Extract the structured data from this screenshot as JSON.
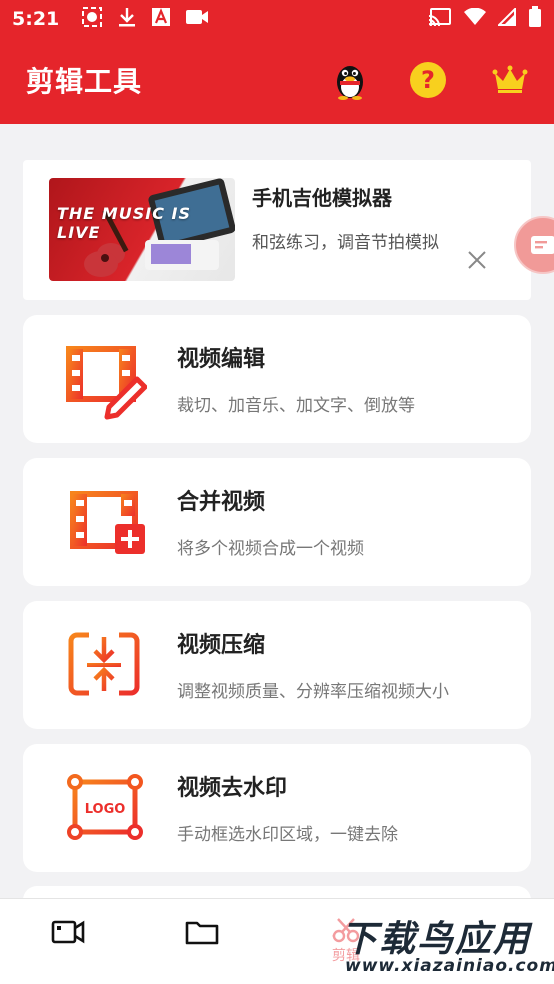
{
  "status_bar": {
    "time": "5:21"
  },
  "app_bar": {
    "title": "剪辑工具"
  },
  "banner": {
    "image_text": "THE MUSIC IS LIVE",
    "title": "手机吉他模拟器",
    "subtitle": "和弦练习，调音节拍模拟"
  },
  "tools": [
    {
      "title": "视频编辑",
      "subtitle": "裁切、加音乐、加文字、倒放等",
      "icon": "film-edit-icon"
    },
    {
      "title": "合并视频",
      "subtitle": "将多个视频合成一个视频",
      "icon": "film-add-icon"
    },
    {
      "title": "视频压缩",
      "subtitle": "调整视频质量、分辨率压缩视频大小",
      "icon": "compress-icon"
    },
    {
      "title": "视频去水印",
      "subtitle": "手动框选水印区域，一键去除",
      "icon": "logo-frame-icon",
      "icon_text": "LOGO"
    }
  ],
  "bottom_nav": {
    "items": [
      {
        "icon": "video-camera-icon"
      },
      {
        "icon": "folder-icon"
      },
      {
        "icon": "scissors-icon",
        "label": "剪辑"
      }
    ]
  },
  "watermark": {
    "main": "下载鸟应用",
    "sub": "www.xiazainiao.com"
  },
  "colors": {
    "primary": "#e5252b",
    "accent_orange": "#f26a1b",
    "background": "#f2f2f4"
  }
}
